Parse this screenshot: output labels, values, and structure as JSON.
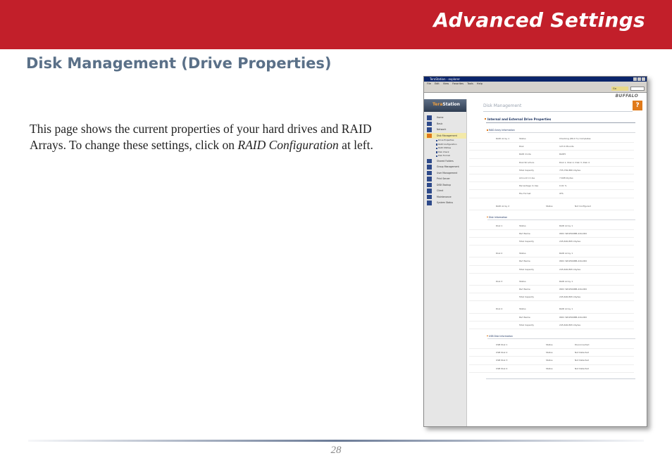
{
  "header": {
    "title": "Advanced Settings"
  },
  "section_title": "Disk Management (Drive Properties)",
  "body": {
    "text_before": "This page shows the current properties of your hard drives and RAID Arrays.  To change these settings, click on ",
    "link_text": "RAID Configuration",
    "text_after": " at left."
  },
  "footer": {
    "page_number": "28"
  },
  "screenshot": {
    "window_title": "TeraStation - explorer",
    "menu_bar": "File Edit View Favorites Tools Help",
    "go_label": "Go",
    "logo": "BUFFALO",
    "brand_a": "Tera",
    "brand_b": "Station",
    "page_title": "Disk Management",
    "help_glyph": "?",
    "nav": [
      {
        "label": "Home",
        "type": "item"
      },
      {
        "label": "Basic",
        "type": "item"
      },
      {
        "label": "Network",
        "type": "item"
      },
      {
        "label": "Disk Management",
        "type": "active"
      },
      {
        "label": "Drive Properties",
        "type": "sub"
      },
      {
        "label": "RAID Configuration",
        "type": "sub"
      },
      {
        "label": "RAID Utilities",
        "type": "sub"
      },
      {
        "label": "Disk Check",
        "type": "sub"
      },
      {
        "label": "Disk Format",
        "type": "sub"
      },
      {
        "label": "Shared Folders",
        "type": "item"
      },
      {
        "label": "Group Management",
        "type": "item"
      },
      {
        "label": "User Management",
        "type": "item"
      },
      {
        "label": "Print Server",
        "type": "item"
      },
      {
        "label": "DISK Backup",
        "type": "item"
      },
      {
        "label": "Client",
        "type": "item"
      },
      {
        "label": "Maintenance",
        "type": "item"
      },
      {
        "label": "System Status",
        "type": "item"
      }
    ],
    "main_title": "Internal and External Drive Properties",
    "raid_section": "RAID Array Information",
    "raid_rows": [
      [
        "RAID Array 1",
        "Status",
        "Checking (89.4 %) Completes"
      ],
      [
        "",
        "Disk",
        "123 4 Mounts"
      ],
      [
        "",
        "RAID mode",
        "RAID5"
      ],
      [
        "",
        "Disk Structure",
        "Disk 1, Disk 2, Disk 3, Disk 4"
      ],
      [
        "",
        "Total Capacity",
        "735,782,880 kbytes"
      ],
      [
        "",
        "Amount in Use",
        "7,648 kbytes"
      ],
      [
        "",
        "Percentage In Use",
        "0.01 %"
      ],
      [
        "",
        "File Format",
        "XFS"
      ]
    ],
    "raid2_row": [
      "RAID Array 2",
      "Status",
      "Not Configured"
    ],
    "disk_section": "Disk Information",
    "disks": [
      [
        [
          "Disk 1",
          "Status",
          "RAID Array 1"
        ],
        [
          "",
          "Part Name",
          "WDC WD2500BB-22GUD0"
        ],
        [
          "",
          "Total Capacity",
          "245,600,895 kbytes"
        ]
      ],
      [
        [
          "Disk 2",
          "Status",
          "RAID Array 1"
        ],
        [
          "",
          "Part Name",
          "WDC WD2500BB-22GUD0"
        ],
        [
          "",
          "Total Capacity",
          "245,600,895 kbytes"
        ]
      ],
      [
        [
          "Disk 3",
          "Status",
          "RAID Array 1"
        ],
        [
          "",
          "Part Name",
          "WDC WD2500BB-22GUD0"
        ],
        [
          "",
          "Total Capacity",
          "245,600,895 kbytes"
        ]
      ],
      [
        [
          "Disk 4",
          "Status",
          "RAID Array 1"
        ],
        [
          "",
          "Part Name",
          "WDC WD2500BB-22GUD0"
        ],
        [
          "",
          "Total Capacity",
          "245,600,895 kbytes"
        ]
      ]
    ],
    "usb_section": "USB Disk Information",
    "usb_rows": [
      [
        "USB Disk 1",
        "Status",
        "Disconnected"
      ],
      [
        "USB Disk 2",
        "Status",
        "Not Detected"
      ],
      [
        "USB Disk 3",
        "Status",
        "Not Detected"
      ],
      [
        "USB Disk 4",
        "Status",
        "Not Detected"
      ]
    ]
  }
}
